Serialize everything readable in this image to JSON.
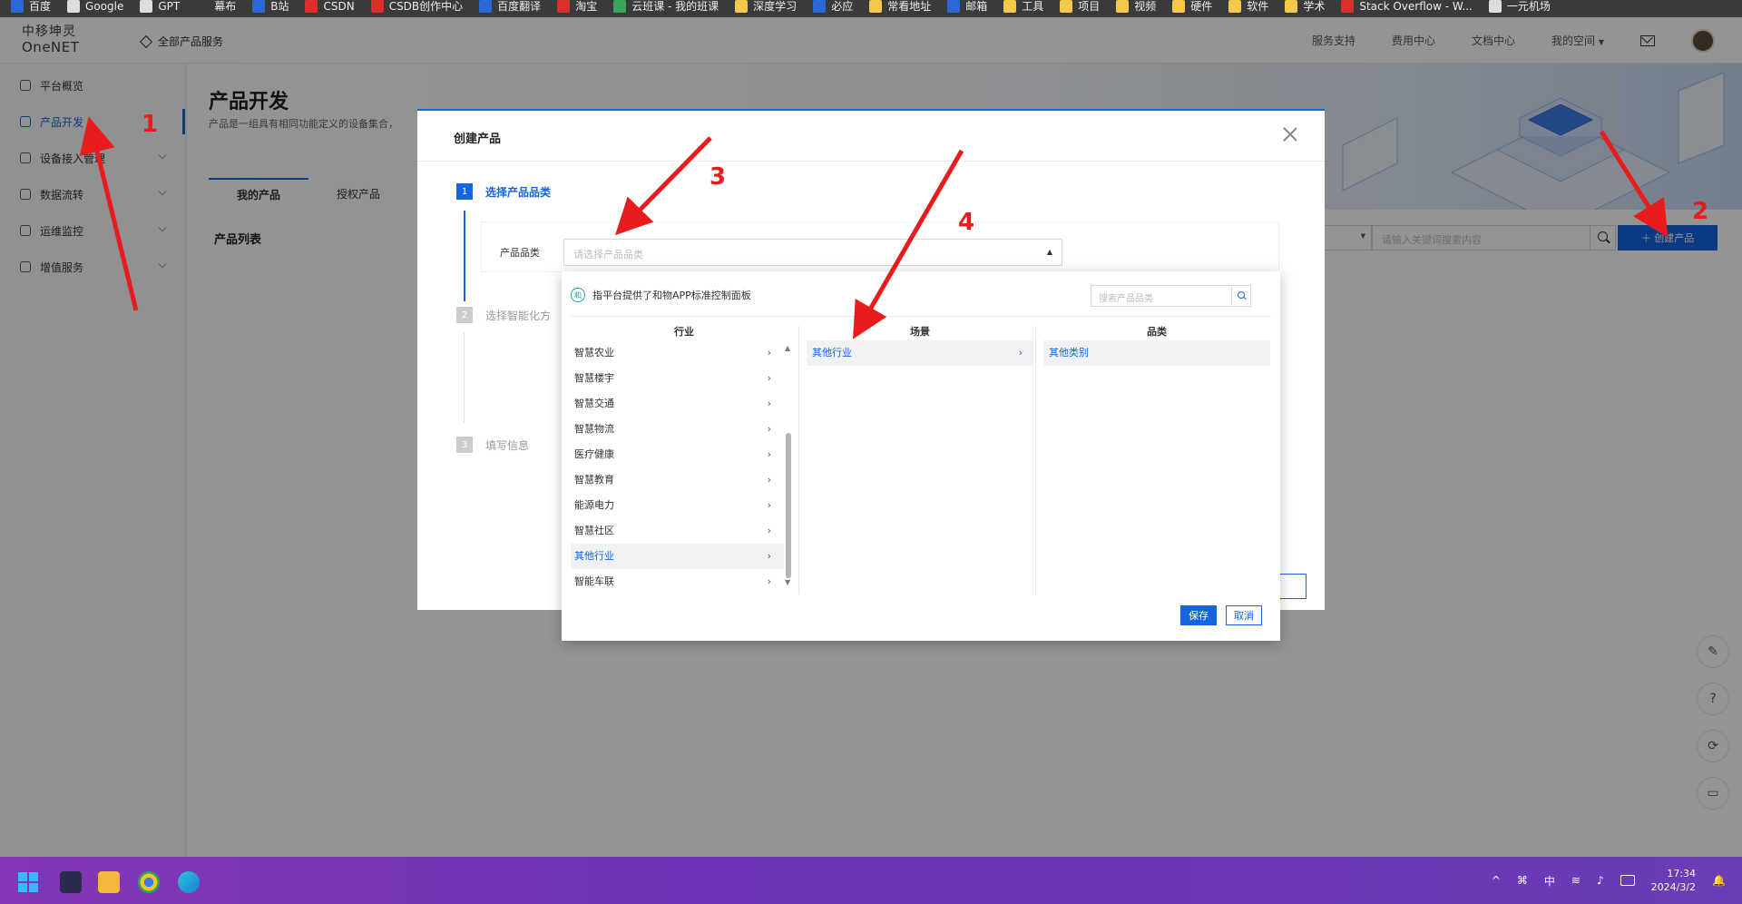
{
  "bookmarks": [
    {
      "label": "百度",
      "color": "#2a6ad8"
    },
    {
      "label": "Google",
      "color": "#dddddd"
    },
    {
      "label": "GPT",
      "color": "#dddddd"
    },
    {
      "label": "幕布",
      "color": "#3a3a3a"
    },
    {
      "label": "B站",
      "color": "#2a6ad8"
    },
    {
      "label": "CSDN",
      "color": "#d9302c"
    },
    {
      "label": "CSDB创作中心",
      "color": "#d9302c"
    },
    {
      "label": "百度翻译",
      "color": "#2a6ad8"
    },
    {
      "label": "淘宝",
      "color": "#d9302c"
    },
    {
      "label": "云班课 - 我的班课",
      "color": "#3aa55a"
    },
    {
      "label": "深度学习",
      "color": "#f5c84a"
    },
    {
      "label": "必应",
      "color": "#2a6ad8"
    },
    {
      "label": "常看地址",
      "color": "#f5c84a"
    },
    {
      "label": "邮箱",
      "color": "#2a6ad8"
    },
    {
      "label": "工具",
      "color": "#f5c84a"
    },
    {
      "label": "项目",
      "color": "#f5c84a"
    },
    {
      "label": "视频",
      "color": "#f5c84a"
    },
    {
      "label": "硬件",
      "color": "#f5c84a"
    },
    {
      "label": "软件",
      "color": "#f5c84a"
    },
    {
      "label": "学术",
      "color": "#f5c84a"
    },
    {
      "label": "Stack Overflow - W...",
      "color": "#d9302c"
    },
    {
      "label": "一元机场",
      "color": "#dddddd"
    }
  ],
  "logo": {
    "cn": "中移坤灵",
    "en": "OneNET"
  },
  "topnav": {
    "all_products": "全部产品服务",
    "service_support": "服务支持",
    "billing": "费用中心",
    "docs": "文档中心",
    "my_space": "我的空间"
  },
  "sidebar": {
    "items": [
      {
        "label": "平台概览"
      },
      {
        "label": "产品开发"
      },
      {
        "label": "设备接入管理"
      },
      {
        "label": "数据流转"
      },
      {
        "label": "运维监控"
      },
      {
        "label": "增值服务"
      }
    ]
  },
  "page": {
    "title": "产品开发",
    "desc": "产品是一组具有相同功能定义的设备集合，",
    "tabs": [
      "我的产品",
      "授权产品"
    ],
    "list_title": "产品列表",
    "keyword_placeholder": "请输入关键词搜索内容",
    "create_button": "＋  创建产品"
  },
  "modal": {
    "title": "创建产品",
    "steps": [
      {
        "num": "1",
        "label": "选择产品品类"
      },
      {
        "num": "2",
        "label": "选择智能化方"
      },
      {
        "num": "3",
        "label": "填写信息"
      }
    ],
    "category_label": "产品品类",
    "category_placeholder": "请选择产品品类"
  },
  "cascade": {
    "badge": "和",
    "info": "指平台提供了和物APP标准控制面板",
    "search_placeholder": "搜索产品品类",
    "columns": [
      "行业",
      "场景",
      "品类"
    ],
    "industries": [
      "智慧农业",
      "智慧楼宇",
      "智慧交通",
      "智慧物流",
      "医疗健康",
      "智慧教育",
      "能源电力",
      "智慧社区",
      "其他行业",
      "智能车联"
    ],
    "selected_industry": "其他行业",
    "scene": "其他行业",
    "category": "其他类别",
    "save": "保存",
    "cancel": "取消"
  },
  "annotations": [
    "1",
    "2",
    "3",
    "4"
  ],
  "taskbar": {
    "time": "17:34",
    "date": "2024/3/2",
    "ime": "中"
  }
}
